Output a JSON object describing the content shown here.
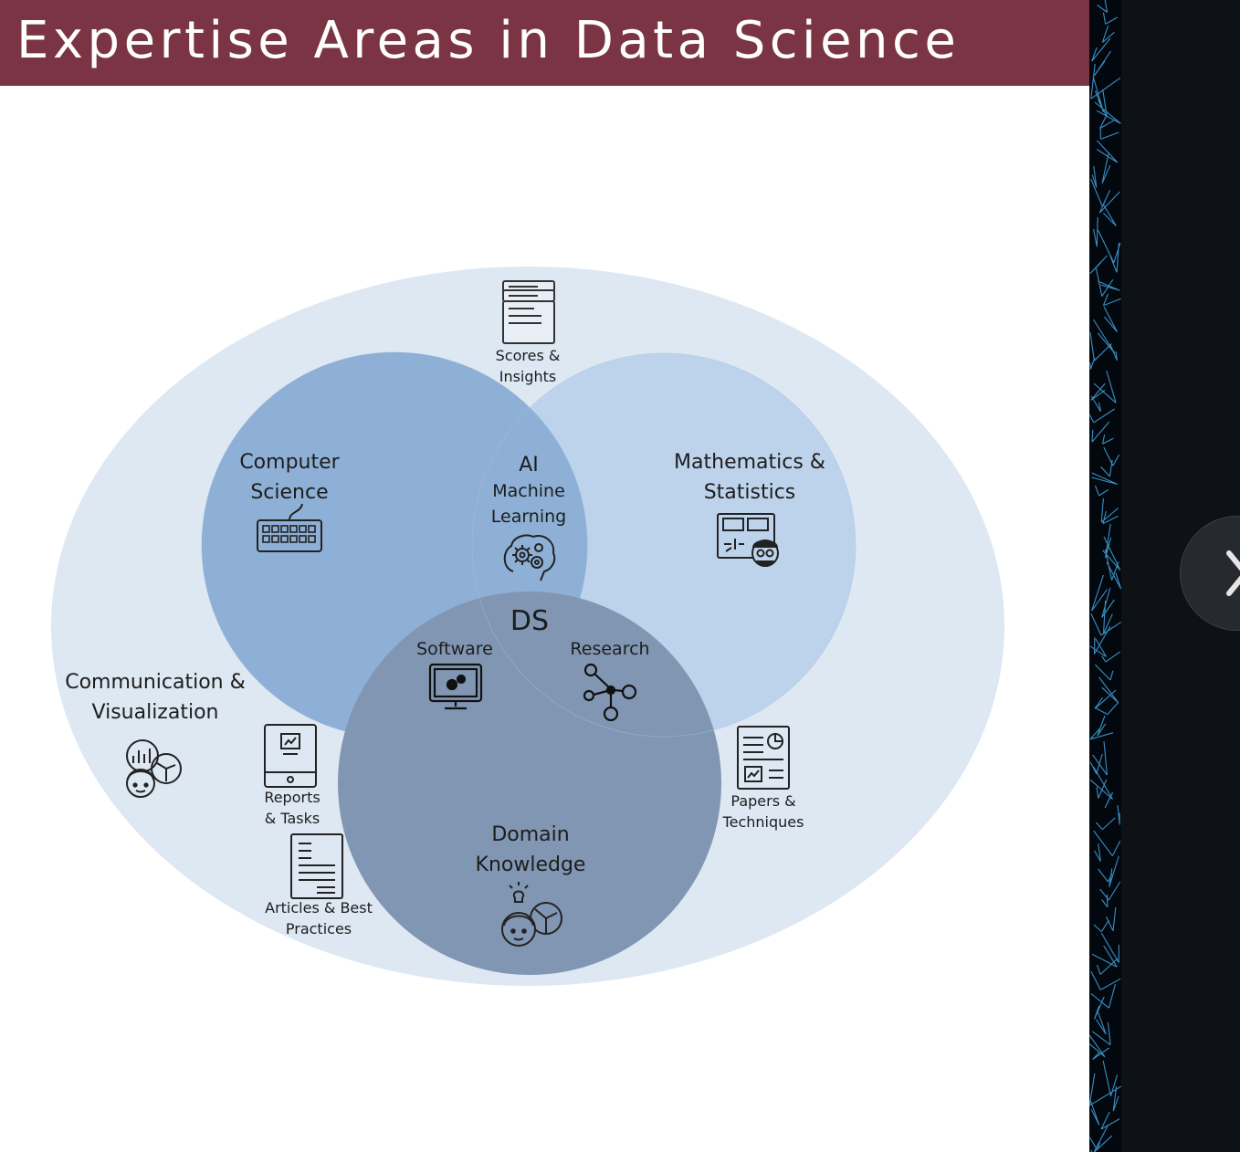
{
  "slide": {
    "title": "Expertise Areas in Data Science",
    "title_bar_color": "#7b3443"
  },
  "venn": {
    "circles": {
      "computer_science": [
        "Computer",
        "Science"
      ],
      "mathematics_statistics": [
        "Mathematics &",
        "Statistics"
      ],
      "domain_knowledge": [
        "Domain",
        "Knowledge"
      ]
    },
    "intersections": {
      "ai_ml": [
        "AI",
        "Machine",
        "Learning"
      ],
      "center": "DS",
      "software": "Software",
      "research": "Research"
    },
    "outer_labels": {
      "communication_visualization": [
        "Communication &",
        "Visualization"
      ],
      "scores_insights": [
        "Scores &",
        "Insights"
      ],
      "reports_tasks": [
        "Reports",
        "& Tasks"
      ],
      "articles_best_practices": [
        "Articles & Best",
        "Practices"
      ],
      "papers_techniques": [
        "Papers &",
        "Techniques"
      ]
    },
    "colors": {
      "outer_ellipse": "#dde8f3",
      "computer_science": "#8eb0d6",
      "mathematics_statistics": "#bdd3eb",
      "domain_knowledge": "#8196b2"
    },
    "icons": [
      "document-stack-icon",
      "keyboard-icon",
      "brain-gears-icon",
      "math-teacher-icon",
      "monitor-gears-icon",
      "network-nodes-icon",
      "audience-chart-icon",
      "tablet-report-icon",
      "article-document-icon",
      "paper-chart-icon",
      "heads-lightbulb-icon"
    ]
  },
  "navigation": {
    "next_icon": "chevron-right-icon"
  }
}
